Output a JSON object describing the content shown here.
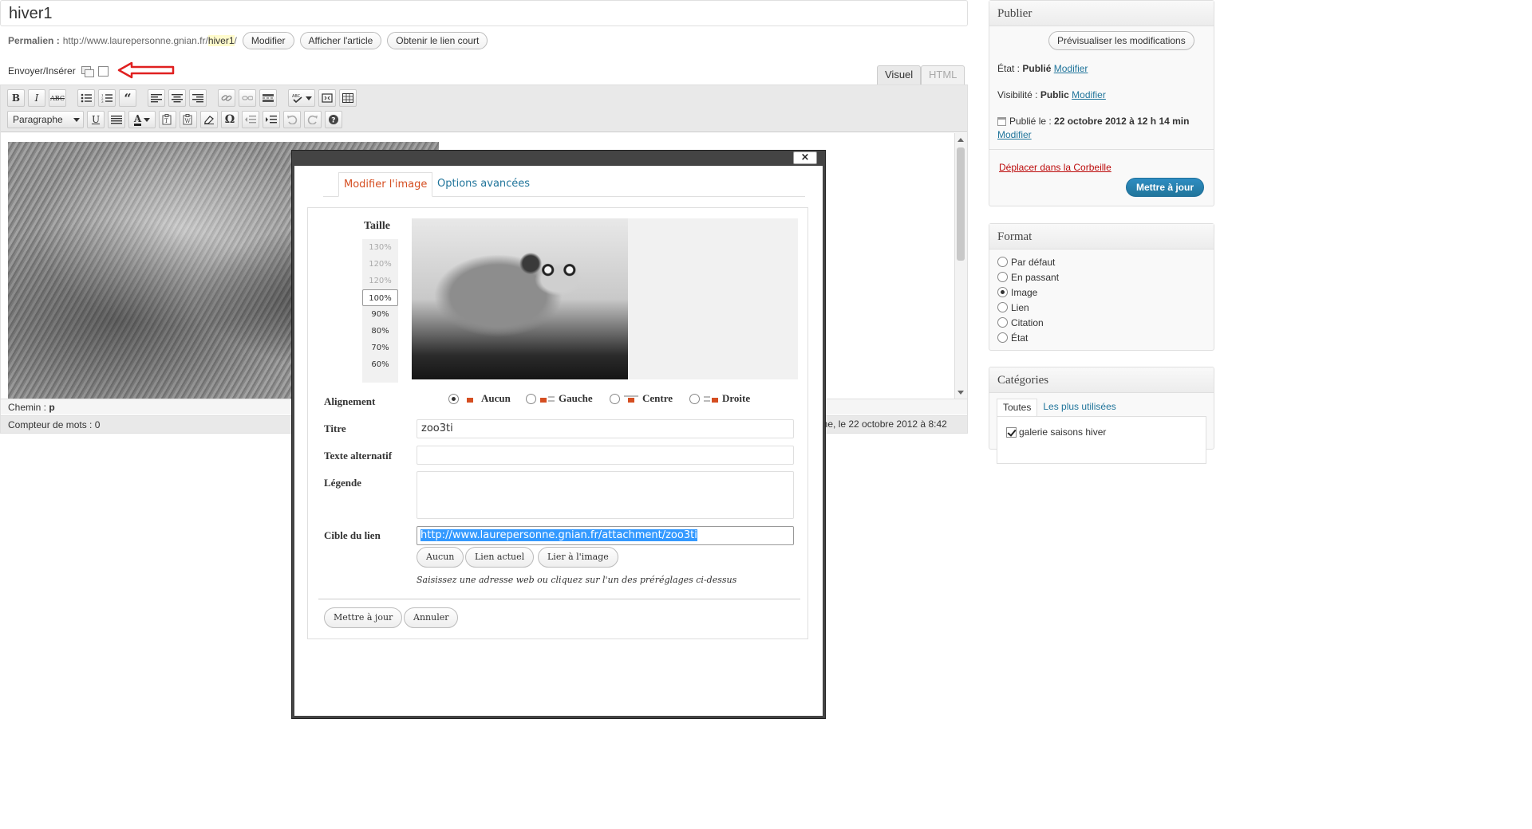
{
  "post": {
    "title": "hiver1"
  },
  "permalink": {
    "label": "Permalien :",
    "base_url": "http://www.laurepersonne.gnian.fr/",
    "slug": "hiver1",
    "trailing": "/",
    "edit_button": "Modifier",
    "view_button": "Afficher l'article",
    "shortlink_button": "Obtenir le lien court"
  },
  "upload": {
    "label": "Envoyer/Insérer",
    "icon": "media-library-icon"
  },
  "editor": {
    "tab_visual": "Visuel",
    "tab_html": "HTML",
    "format_select": "Paragraphe",
    "path_label": "Chemin :",
    "path_value": "p",
    "word_count_label": "Compteur de mots :",
    "word_count": "0",
    "last_edit": "nne, le 22 octobre 2012 à 8:42"
  },
  "publish": {
    "heading": "Publier",
    "preview_button": "Prévisualiser les modifications",
    "status_label": "État :",
    "status_value": "Publié",
    "visibility_label": "Visibilité :",
    "visibility_value": "Public",
    "published_label": "Publié le :",
    "published_value": "22 octobre 2012 à 12 h 14 min",
    "edit_link": "Modifier",
    "trash_link": "Déplacer dans la Corbeille",
    "update_button": "Mettre à jour"
  },
  "format": {
    "heading": "Format",
    "options": [
      "Par défaut",
      "En passant",
      "Image",
      "Lien",
      "Citation",
      "État"
    ],
    "selected": "Image"
  },
  "categories": {
    "heading": "Catégories",
    "tab_all": "Toutes",
    "tab_popular": "Les plus utilisées",
    "items": [
      {
        "label": "galerie saisons hiver",
        "checked": true
      }
    ]
  },
  "modal": {
    "close_symbol": "×",
    "tab_edit": "Modifier l'image",
    "tab_advanced": "Options avancées",
    "size_label": "Taille",
    "sizes": [
      "130%",
      "120%",
      "120%",
      "100%",
      "90%",
      "80%",
      "70%",
      "60%"
    ],
    "selected_size": "100%",
    "align_label": "Alignement",
    "align_options": [
      "Aucun",
      "Gauche",
      "Centre",
      "Droite"
    ],
    "align_selected": "Aucun",
    "title_label": "Titre",
    "title_value": "zoo3ti",
    "alt_label": "Texte alternatif",
    "alt_value": "",
    "caption_label": "Légende",
    "caption_value": "",
    "link_label": "Cible du lien",
    "link_value": "http://www.laurepersonne.gnian.fr/attachment/zoo3ti",
    "link_none": "Aucun",
    "link_current": "Lien actuel",
    "link_image": "Lier à l'image",
    "help_text": "Saisissez une adresse web ou cliquez sur l'un des préréglages ci-dessus",
    "update_button": "Mettre à jour",
    "cancel_button": "Annuler"
  },
  "colors": {
    "accent_blue": "#21759b",
    "active_tab_orange": "#d54e21",
    "trash_red": "#bc0b0b",
    "annotation_arrow": "#e02020"
  }
}
